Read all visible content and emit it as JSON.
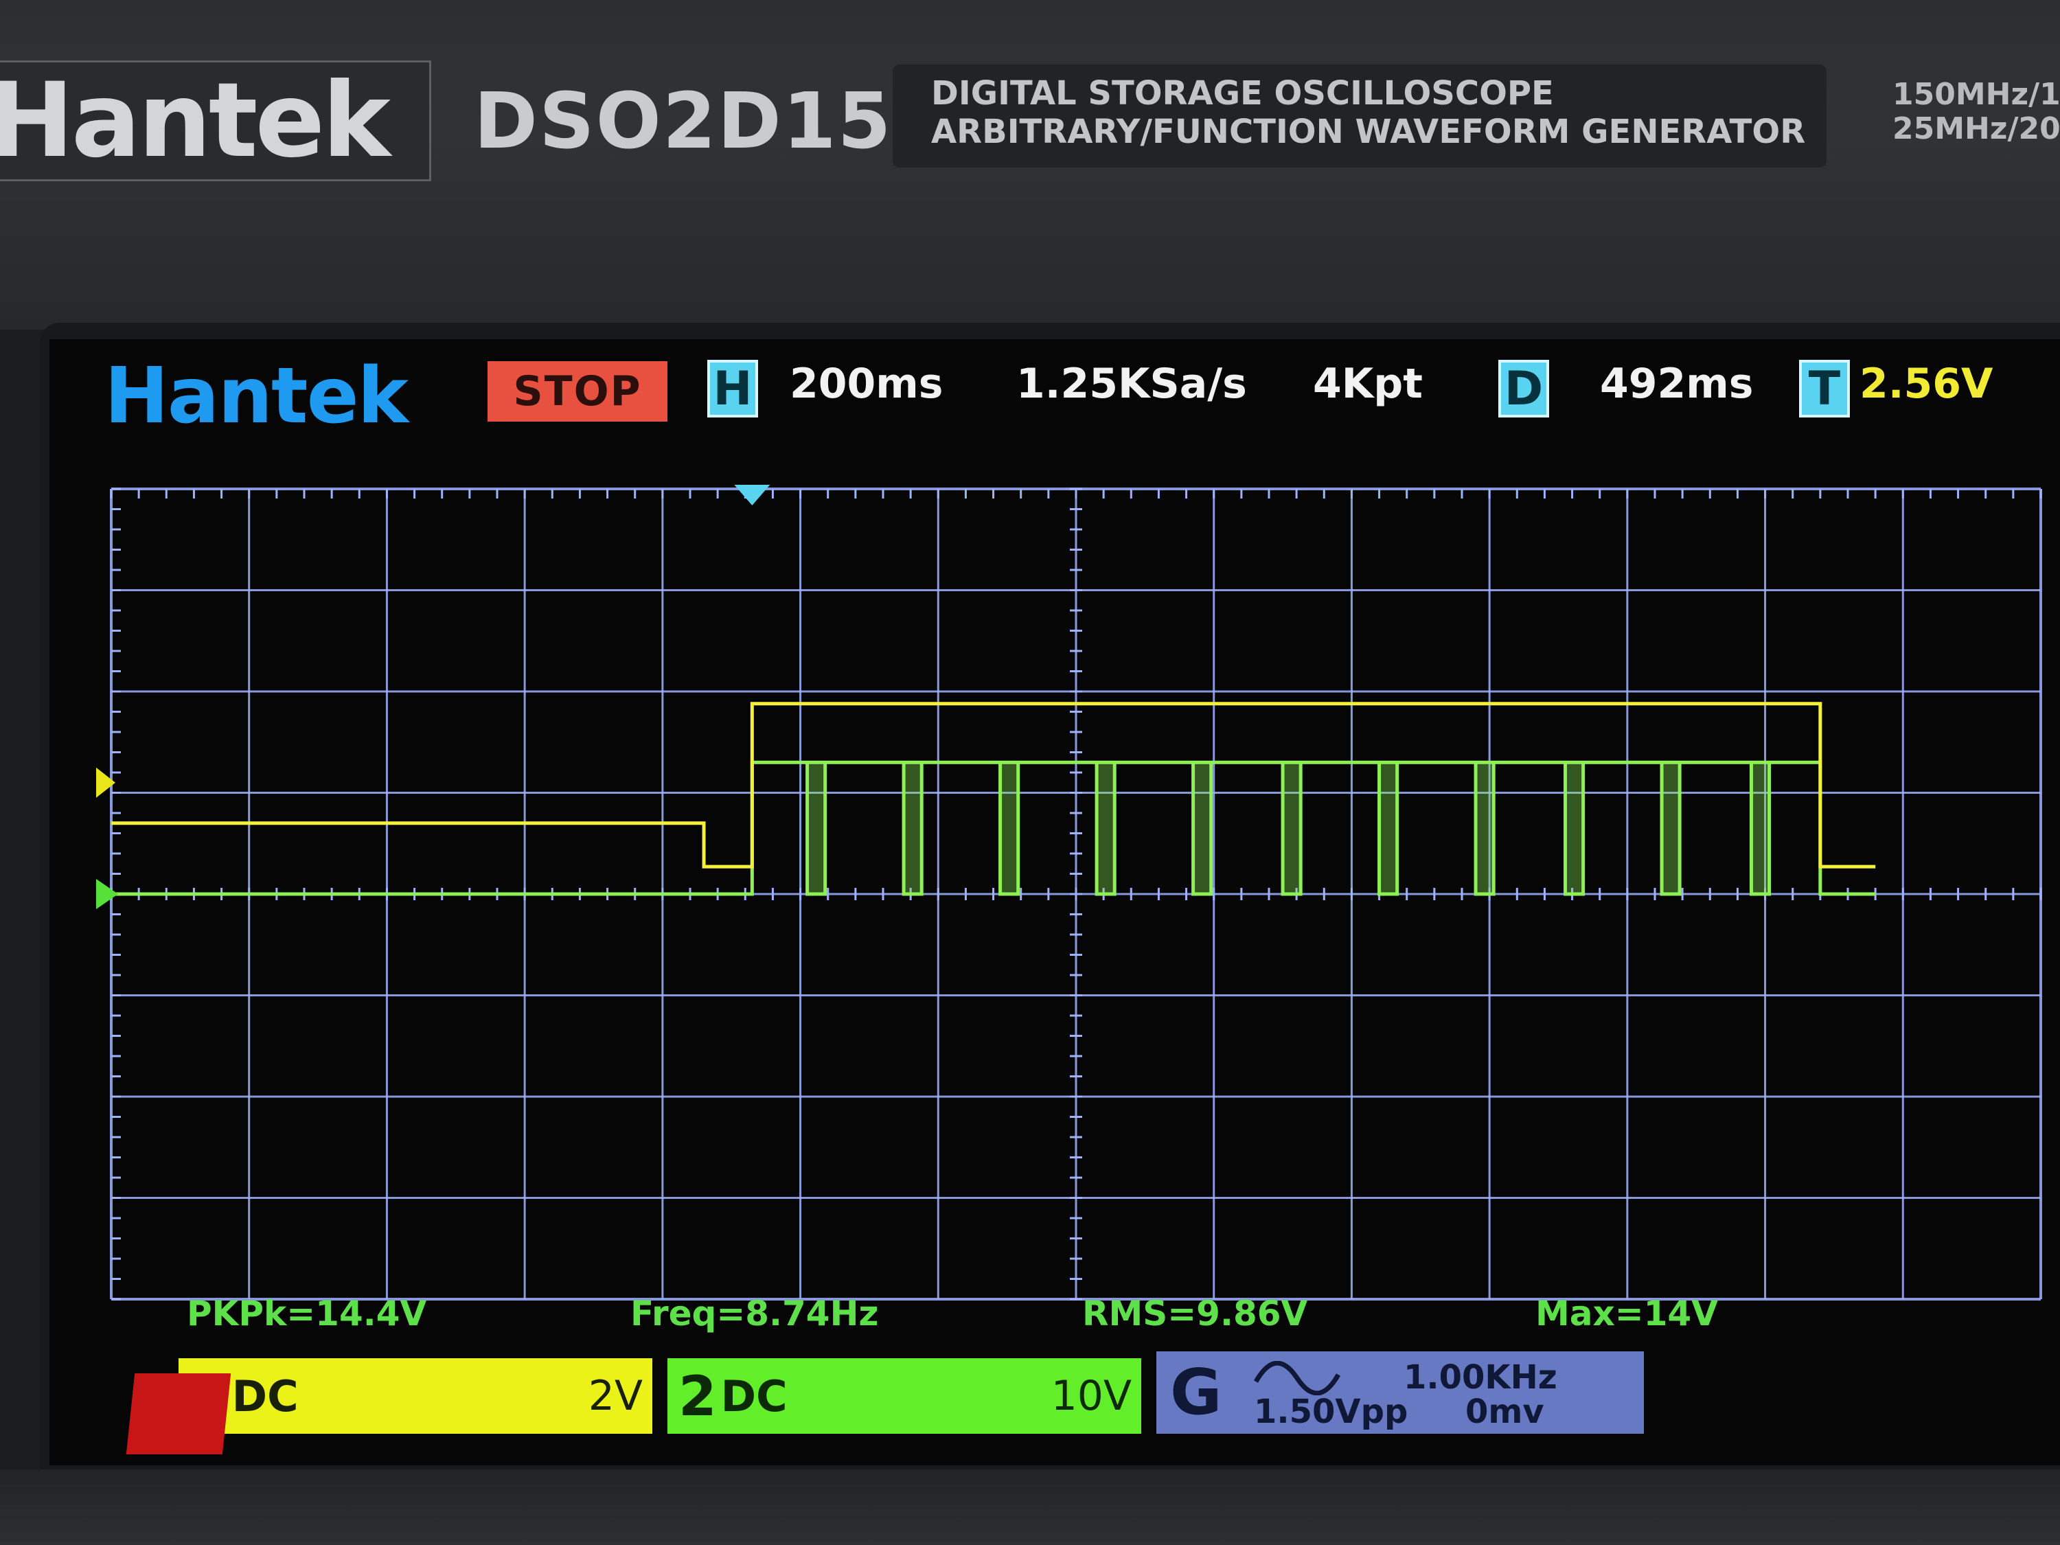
{
  "device": {
    "brand": "Hantek",
    "model": "DSO2D15",
    "description_line1": "DIGITAL STORAGE OSCILLOSCOPE",
    "description_line2": "ARBITRARY/FUNCTION WAVEFORM GENERATOR",
    "spec_line1": "150MHz/1",
    "spec_line2": "25MHz/20"
  },
  "screen": {
    "brand": "Hantek",
    "run_state": "STOP",
    "horizontal": {
      "icon_letter": "H",
      "timebase": "200ms"
    },
    "sample_rate": "1.25KSa/s",
    "memory_depth": "4Kpt",
    "delay": {
      "icon_letter": "D",
      "value": "492ms"
    },
    "trigger": {
      "icon_letter": "T",
      "level": "2.56V"
    }
  },
  "measurements": [
    {
      "label": "PKPk=14.4V"
    },
    {
      "label": "Freq=8.74Hz"
    },
    {
      "label": "RMS=9.86V"
    },
    {
      "label": "Max=14V"
    }
  ],
  "channels": [
    {
      "number": "1",
      "coupling": "DC",
      "scale": "2V",
      "color": "#eaf217"
    },
    {
      "number": "2",
      "coupling": "DC",
      "scale": "10V",
      "color": "#63ee2a"
    }
  ],
  "generator": {
    "letter": "G",
    "waveform": "sine-wave-icon",
    "frequency": "1.00KHz",
    "amplitude": "1.50Vpp",
    "offset": "0mv"
  },
  "colors": {
    "grid": "#9fb2ff",
    "ch1_trace": "#f2f03a",
    "ch2_trace": "#8ff055",
    "stop_badge": "#e8503f",
    "info_icon": "#5ad3f0"
  },
  "chart_data": {
    "type": "line",
    "x_divisions": 14,
    "y_divisions": 8,
    "series": [
      {
        "name": "1",
        "x": [
          0,
          4.3,
          4.3,
          4.65,
          4.65,
          12.4,
          12.4,
          12.8
        ],
        "y": [
          0.7,
          0.7,
          0.27,
          0.27,
          1.88,
          1.88,
          0.27,
          0.27
        ]
      },
      {
        "name": "2",
        "x": [
          0,
          4.65,
          4.65,
          12.4,
          12.4,
          12.8
        ],
        "y": [
          0,
          0,
          1.3,
          1.3,
          0,
          0
        ],
        "pulse_low_x": [
          5.05,
          5.75,
          6.45,
          7.15,
          7.85,
          8.5,
          9.2,
          9.9,
          10.55,
          11.25,
          11.9
        ]
      }
    ]
  }
}
